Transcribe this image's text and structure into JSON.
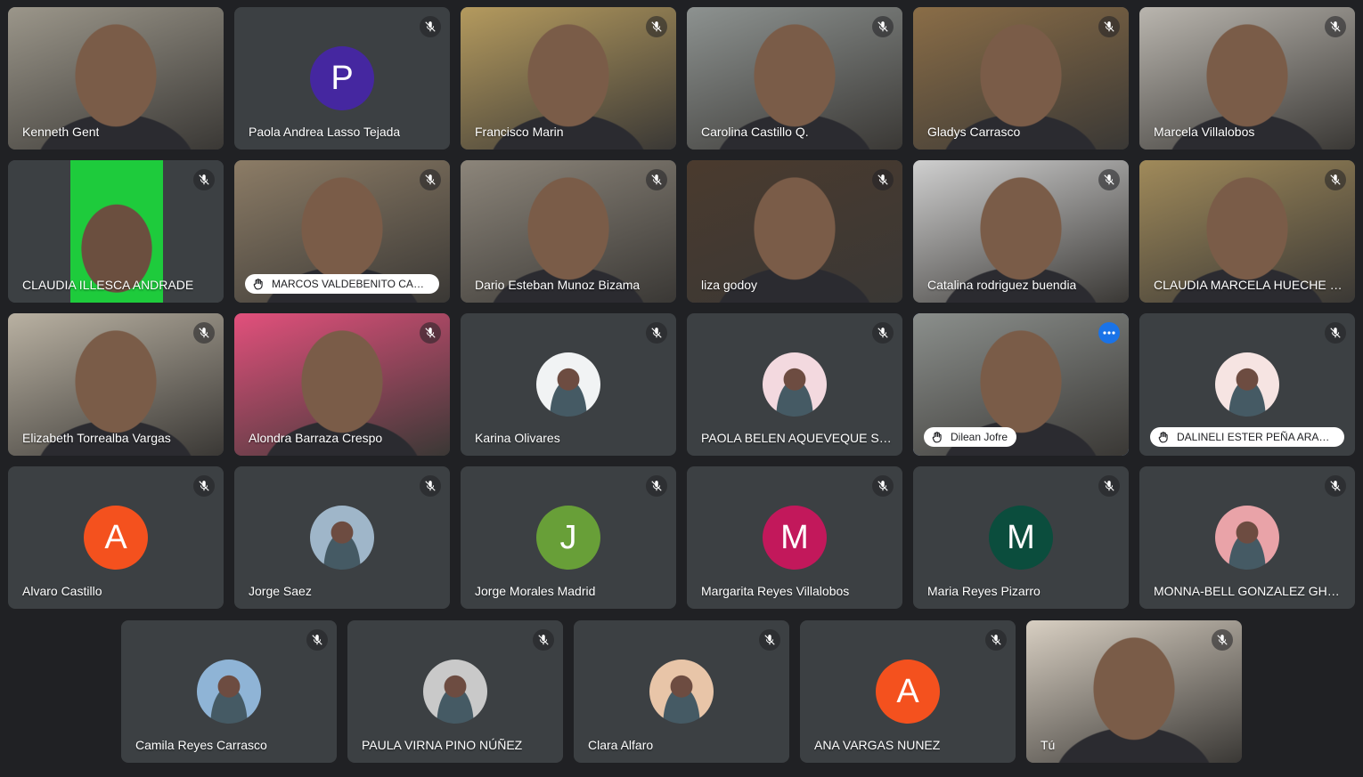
{
  "participants": [
    {
      "name": "Kenneth Gent",
      "kind": "video",
      "bg": "#9b968a",
      "muted": false
    },
    {
      "name": "Paola Andrea Lasso Tejada",
      "kind": "letter",
      "letter": "P",
      "color": "#4527a0",
      "muted": true
    },
    {
      "name": "Francisco Marin",
      "kind": "video",
      "bg": "#b49a5e",
      "muted": true
    },
    {
      "name": "Carolina Castillo Q.",
      "kind": "video",
      "bg": "#8d9290",
      "muted": true
    },
    {
      "name": "Gladys Carrasco",
      "kind": "video",
      "bg": "#8a6d47",
      "muted": true
    },
    {
      "name": "Marcela Villalobos",
      "kind": "video",
      "bg": "#b9b5ae",
      "muted": true
    },
    {
      "name": "CLAUDIA ILLESCA ANDRADE",
      "kind": "video",
      "bg": "#3a3c3f",
      "muted": true
    },
    {
      "name": "MARCOS VALDEBENITO CAS…",
      "kind": "video",
      "bg": "#8c7c66",
      "muted": true,
      "hand": true
    },
    {
      "name": "Dario Esteban Munoz Bizama",
      "kind": "video",
      "bg": "#8c857a",
      "muted": true
    },
    {
      "name": "liza godoy",
      "kind": "video",
      "bg": "#4a3a2e",
      "muted": true
    },
    {
      "name": "Catalina rodriguez buendia",
      "kind": "video",
      "bg": "#cfcfcf",
      "muted": true
    },
    {
      "name": "CLAUDIA MARCELA HUECHE …",
      "kind": "video",
      "bg": "#a08a5a",
      "muted": true
    },
    {
      "name": "Elizabeth Torrealba Vargas",
      "kind": "video",
      "bg": "#b9b1a2",
      "muted": true
    },
    {
      "name": "Alondra Barraza Crespo",
      "kind": "video",
      "bg": "#e2507c",
      "muted": true
    },
    {
      "name": "Karina Olivares",
      "kind": "photo",
      "color": "#f1f3f4",
      "muted": true
    },
    {
      "name": "PAOLA BELEN AQUEVEQUE S…",
      "kind": "photo",
      "color": "#f3d9df",
      "muted": true
    },
    {
      "name": "Dilean Jofre",
      "kind": "video",
      "bg": "#8b8f8c",
      "muted": false,
      "hand": true,
      "active": true,
      "more": true
    },
    {
      "name": "DALINELI ESTER PEÑA ARAN…",
      "kind": "photo",
      "color": "#f6e4e2",
      "muted": true,
      "hand": true
    },
    {
      "name": "Alvaro Castillo",
      "kind": "letter",
      "letter": "A",
      "color": "#f4511e",
      "muted": true
    },
    {
      "name": "Jorge Saez",
      "kind": "photo",
      "color": "#9fb6c9",
      "muted": true
    },
    {
      "name": "Jorge Morales Madrid",
      "kind": "letter",
      "letter": "J",
      "color": "#689f38",
      "muted": true
    },
    {
      "name": "Margarita Reyes Villalobos",
      "kind": "letter",
      "letter": "M",
      "color": "#c2185b",
      "muted": true
    },
    {
      "name": "Maria Reyes Pizarro",
      "kind": "letter",
      "letter": "M",
      "color": "#0b4d3d",
      "muted": true
    },
    {
      "name": "MONNA-BELL GONZALEZ GH…",
      "kind": "photo",
      "color": "#e9a3a8",
      "muted": true
    },
    {
      "name": "Camila Reyes Carrasco",
      "kind": "photo",
      "color": "#8fb4d6",
      "muted": true
    },
    {
      "name": "PAULA VIRNA PINO NÚÑEZ",
      "kind": "photo",
      "color": "#c9c9c9",
      "muted": true
    },
    {
      "name": "Clara Alfaro",
      "kind": "photo",
      "color": "#e8c5a8",
      "muted": true
    },
    {
      "name": "ANA VARGAS NUNEZ",
      "kind": "letter",
      "letter": "A",
      "color": "#f4511e",
      "muted": true
    },
    {
      "name": "Tú",
      "kind": "video",
      "bg": "#d8cfc2",
      "muted": true
    }
  ]
}
